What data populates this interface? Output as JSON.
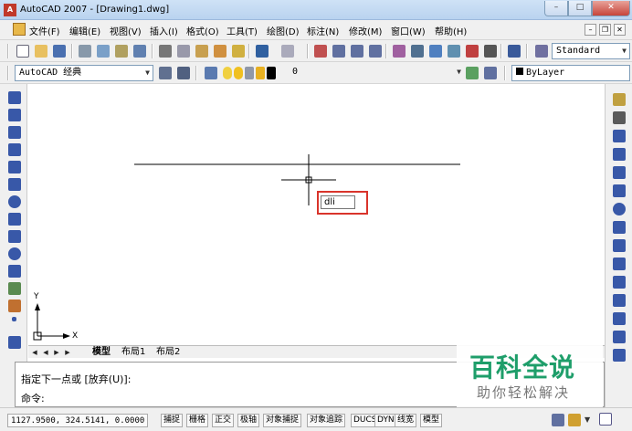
{
  "window": {
    "title": "AutoCAD 2007 - [Drawing1.dwg]",
    "app_icon_text": "A",
    "minimize_glyph": "–",
    "maximize_glyph": "□",
    "close_glyph": "✕"
  },
  "menu": {
    "items": [
      "文件(F)",
      "编辑(E)",
      "视图(V)",
      "插入(I)",
      "格式(O)",
      "工具(T)",
      "绘图(D)",
      "标注(N)",
      "修改(M)",
      "窗口(W)",
      "帮助(H)"
    ],
    "mdi_min": "–",
    "mdi_restore": "❐",
    "mdi_close": "✕"
  },
  "toolbar1": {
    "text_style": "Standard"
  },
  "toolbar2": {
    "workspace": "AutoCAD 经典",
    "layer": "0",
    "color": "ByLayer"
  },
  "canvas": {
    "dynamic_input": "dli",
    "ucs_y": "Y",
    "ucs_x": "X"
  },
  "layout_tabs": {
    "nav": [
      "◀",
      "◀",
      "▶",
      "▶"
    ],
    "tabs": [
      "模型",
      "布局1",
      "布局2"
    ]
  },
  "command": {
    "line1": "指定下一点或 [放弃(U)]:",
    "line2": "命令:"
  },
  "status": {
    "coordinates": "1127.9500,  324.5141,  0.0000",
    "buttons": [
      "捕捉",
      "栅格",
      "正交",
      "极轴",
      "对象捕捉",
      "对象追踪",
      "DUCS",
      "DYN",
      "线宽",
      "模型"
    ]
  },
  "watermark": {
    "title": "百科全说",
    "subtitle": "助你轻松解决"
  },
  "colors": {
    "highlight_box": "#d9342b",
    "watermark_green": "#1e9e6a"
  }
}
